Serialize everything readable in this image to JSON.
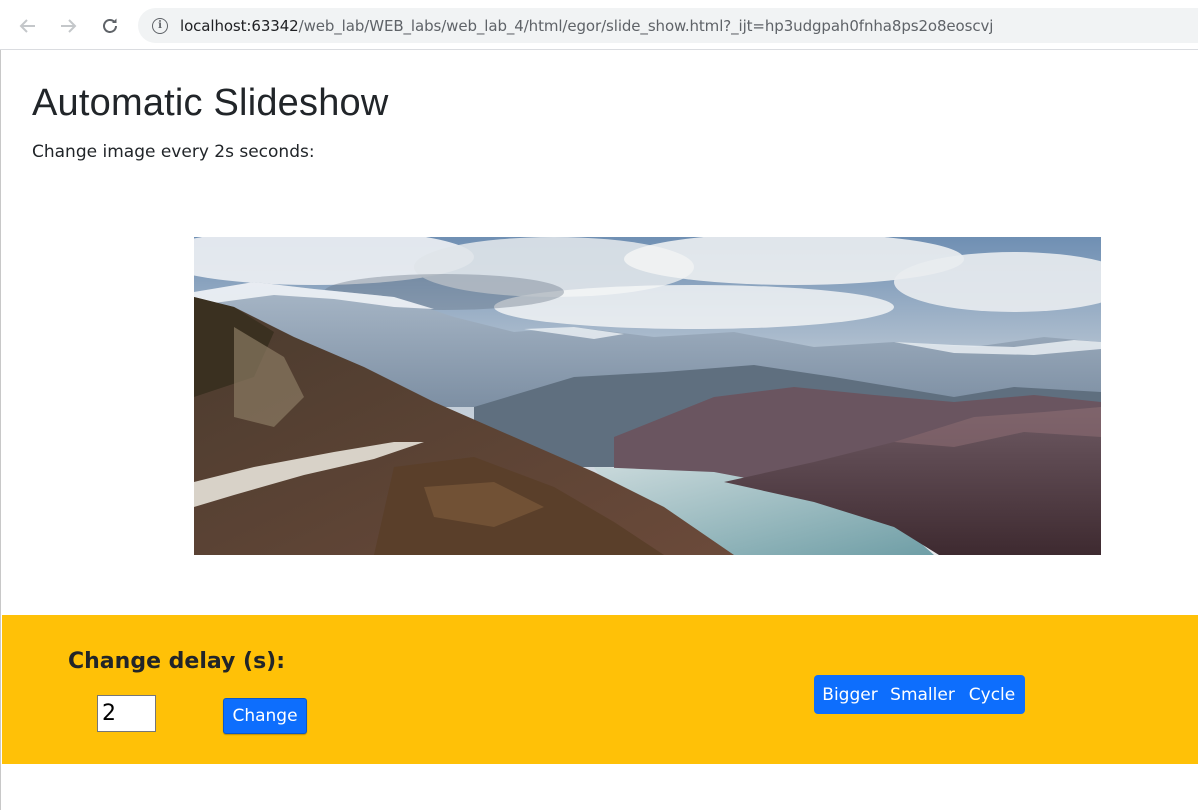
{
  "browser": {
    "url_host": "localhost:63342",
    "url_path": "/web_lab/WEB_labs/web_lab_4/html/egor/slide_show.html?_ijt=hp3udgpah0fnha8ps2o8eoscvj",
    "icons": {
      "back": "arrow-left-icon",
      "forward": "arrow-right-icon",
      "reload": "reload-icon",
      "info": "info-icon"
    }
  },
  "page": {
    "title": "Automatic Slideshow",
    "subtitle": "Change image every 2s seconds:"
  },
  "slide": {
    "image_description": "mountain landscape with winding road and lake"
  },
  "controls": {
    "delay_label": "Change delay (s):",
    "delay_value": "2",
    "change_button": "Change",
    "bigger_button": "Bigger",
    "smaller_button": "Smaller",
    "cycle_button": "Cycle"
  },
  "colors": {
    "panel_bg": "#ffc107",
    "button_bg": "#0d6efd",
    "text": "#212529"
  }
}
